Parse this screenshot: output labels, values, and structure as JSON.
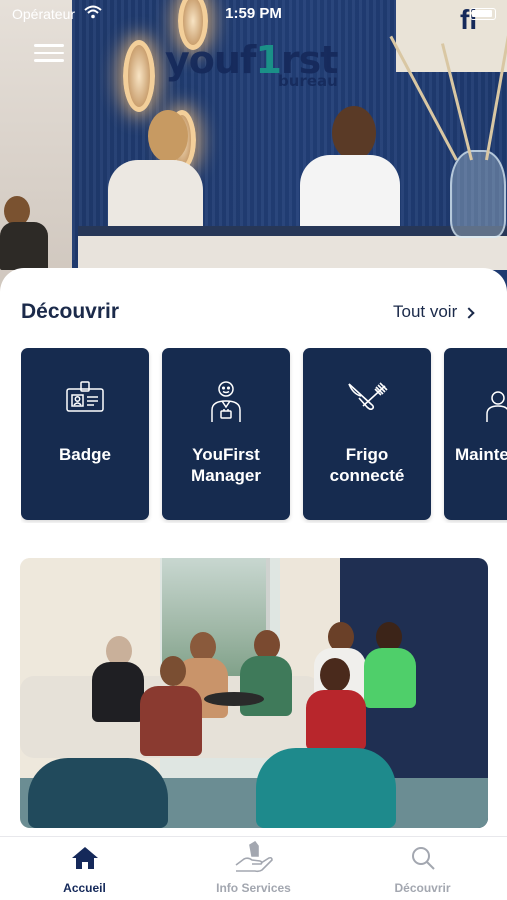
{
  "status_bar": {
    "carrier": "Opérateur",
    "time": "1:59 PM"
  },
  "hero": {
    "brand_name_start": "youf",
    "brand_name_accent": "1",
    "brand_name_end": "rst",
    "brand_sub": "bureau",
    "sign_text": "fi"
  },
  "discover": {
    "title": "Découvrir",
    "see_all": "Tout voir",
    "cards": [
      {
        "label": "Badge",
        "icon": "badge-icon"
      },
      {
        "label": "YouFirst Manager",
        "icon": "manager-icon"
      },
      {
        "label": "Frigo connecté",
        "icon": "fork-knife-icon"
      },
      {
        "label": "Mainte",
        "icon": "maintenance-icon"
      }
    ]
  },
  "tabbar": {
    "tabs": [
      {
        "label": "Accueil",
        "icon": "home-icon",
        "active": true
      },
      {
        "label": "Info Services",
        "icon": "hand-service-icon",
        "active": false
      },
      {
        "label": "Découvrir",
        "icon": "search-icon",
        "active": false
      }
    ]
  },
  "colors": {
    "card_bg": "#162b4f",
    "title": "#1b2a4a",
    "tab_active": "#15295a",
    "tab_inactive": "#a3a7b0"
  }
}
